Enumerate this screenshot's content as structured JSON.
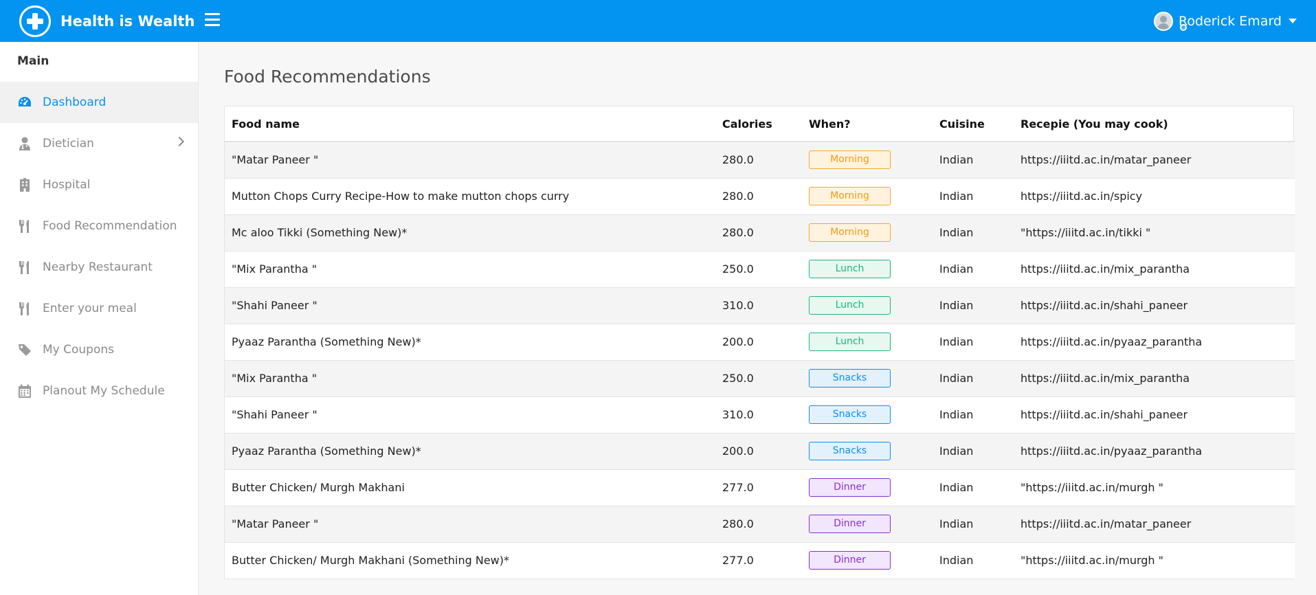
{
  "app": {
    "title": "Health is Wealth"
  },
  "user": {
    "name": "Roderick Emard"
  },
  "sidebar": {
    "section": "Main",
    "items": [
      {
        "label": "Dashboard",
        "icon": "dashboard-icon",
        "active": true
      },
      {
        "label": "Dietician",
        "icon": "doctor-icon",
        "has_submenu": true
      },
      {
        "label": "Hospital",
        "icon": "hospital-icon"
      },
      {
        "label": "Food Recommendation",
        "icon": "cutlery-icon"
      },
      {
        "label": "Nearby Restaurant",
        "icon": "cutlery-icon"
      },
      {
        "label": "Enter your meal",
        "icon": "cutlery-icon"
      },
      {
        "label": "My Coupons",
        "icon": "tag-icon"
      },
      {
        "label": "Planout My Schedule",
        "icon": "calendar-icon"
      }
    ]
  },
  "main": {
    "title": "Food Recommendations",
    "table": {
      "headers": [
        "Food name",
        "Calories",
        "When?",
        "Cuisine",
        "Recepie (You may cook)"
      ],
      "rows": [
        {
          "name": "\"Matar Paneer \"",
          "calories": "280.0",
          "when": "Morning",
          "cuisine": "Indian",
          "recipe": "https://iiitd.ac.in/matar_paneer"
        },
        {
          "name": "Mutton Chops Curry Recipe-How to make mutton chops curry",
          "calories": "280.0",
          "when": "Morning",
          "cuisine": "Indian",
          "recipe": "https://iiitd.ac.in/spicy"
        },
        {
          "name": "Mc aloo Tikki (Something New)*",
          "calories": "280.0",
          "when": "Morning",
          "cuisine": "Indian",
          "recipe": "\"https://iiitd.ac.in/tikki \""
        },
        {
          "name": "\"Mix Parantha \"",
          "calories": "250.0",
          "when": "Lunch",
          "cuisine": "Indian",
          "recipe": "https://iiitd.ac.in/mix_parantha"
        },
        {
          "name": "\"Shahi Paneer \"",
          "calories": "310.0",
          "when": "Lunch",
          "cuisine": "Indian",
          "recipe": "https://iiitd.ac.in/shahi_paneer"
        },
        {
          "name": "Pyaaz Parantha (Something New)*",
          "calories": "200.0",
          "when": "Lunch",
          "cuisine": "Indian",
          "recipe": "https://iiitd.ac.in/pyaaz_parantha"
        },
        {
          "name": "\"Mix Parantha \"",
          "calories": "250.0",
          "when": "Snacks",
          "cuisine": "Indian",
          "recipe": "https://iiitd.ac.in/mix_parantha"
        },
        {
          "name": "\"Shahi Paneer \"",
          "calories": "310.0",
          "when": "Snacks",
          "cuisine": "Indian",
          "recipe": "https://iiitd.ac.in/shahi_paneer"
        },
        {
          "name": "Pyaaz Parantha (Something New)*",
          "calories": "200.0",
          "when": "Snacks",
          "cuisine": "Indian",
          "recipe": "https://iiitd.ac.in/pyaaz_parantha"
        },
        {
          "name": "Butter Chicken/ Murgh Makhani",
          "calories": "277.0",
          "when": "Dinner",
          "cuisine": "Indian",
          "recipe": "\"https://iiitd.ac.in/murgh \""
        },
        {
          "name": "\"Matar Paneer \"",
          "calories": "280.0",
          "when": "Dinner",
          "cuisine": "Indian",
          "recipe": "https://iiitd.ac.in/matar_paneer"
        },
        {
          "name": "Butter Chicken/ Murgh Makhani (Something New)*",
          "calories": "277.0",
          "when": "Dinner",
          "cuisine": "Indian",
          "recipe": "\"https://iiitd.ac.in/murgh \""
        }
      ]
    }
  },
  "colors": {
    "header": "#0394f1",
    "accent": "#0d8fe8",
    "morning": "#f5a623",
    "lunch": "#19b57c",
    "snacks": "#0d8fe8",
    "dinner": "#8b2fd6"
  }
}
